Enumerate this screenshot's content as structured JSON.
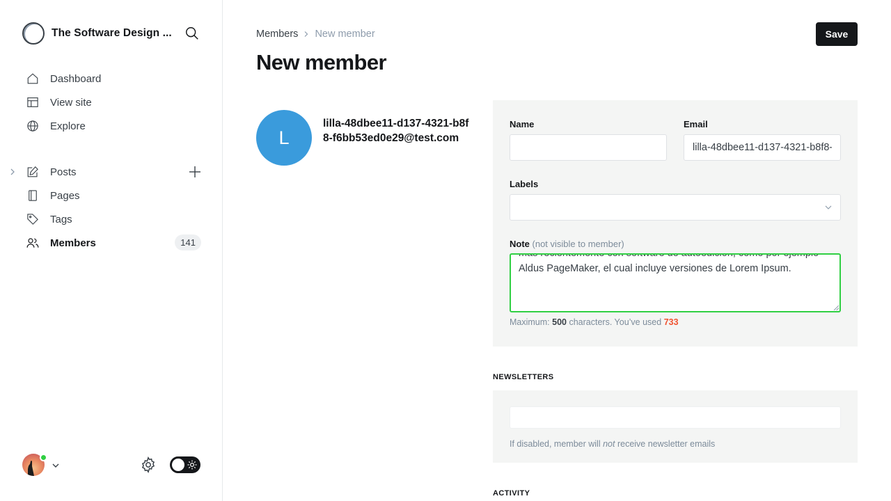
{
  "sidebar": {
    "site_title": "The Software Design ...",
    "nav": [
      {
        "label": "Dashboard",
        "icon": "home-icon"
      },
      {
        "label": "View site",
        "icon": "view-site-icon"
      },
      {
        "label": "Explore",
        "icon": "globe-icon"
      }
    ],
    "content_nav": [
      {
        "label": "Posts",
        "icon": "edit-icon"
      },
      {
        "label": "Pages",
        "icon": "pages-icon"
      },
      {
        "label": "Tags",
        "icon": "tag-icon"
      },
      {
        "label": "Members",
        "icon": "members-icon",
        "count": "141",
        "active": true
      }
    ]
  },
  "breadcrumb": {
    "parent": "Members",
    "current": "New member"
  },
  "page": {
    "title": "New member",
    "save_label": "Save"
  },
  "member": {
    "initial": "L",
    "email_display": "lilla-48dbee11-d137-4321-b8f8-f6bb53ed0e29@test.com"
  },
  "form": {
    "name_label": "Name",
    "name_value": "",
    "email_label": "Email",
    "email_value": "lilla-48dbee11-d137-4321-b8f8-f6bb53ed0e29@test.com",
    "labels_label": "Labels",
    "note_label": "Note",
    "note_sublabel": "(not visible to member)",
    "note_visible_text": "las hojas \"Letraset\", las cuales contenian pasajes de Lorem Ipsum, y más recientemente con software de autoedición, como por ejemplo Aldus PageMaker, el cual incluye versiones de Lorem Ipsum.",
    "hint_prefix": "Maximum:",
    "hint_max": "500",
    "hint_middle": "characters. You’ve used",
    "hint_used": "733"
  },
  "newsletters": {
    "heading": "NEWSLETTERS",
    "hint_before": "If disabled, member will",
    "hint_emph": "not",
    "hint_after": "receive newsletter emails"
  },
  "activity": {
    "heading": "ACTIVITY"
  },
  "colors": {
    "accent_green": "#30cf43",
    "error_orange": "#f05230",
    "avatar_blue": "#3a9bdc"
  }
}
